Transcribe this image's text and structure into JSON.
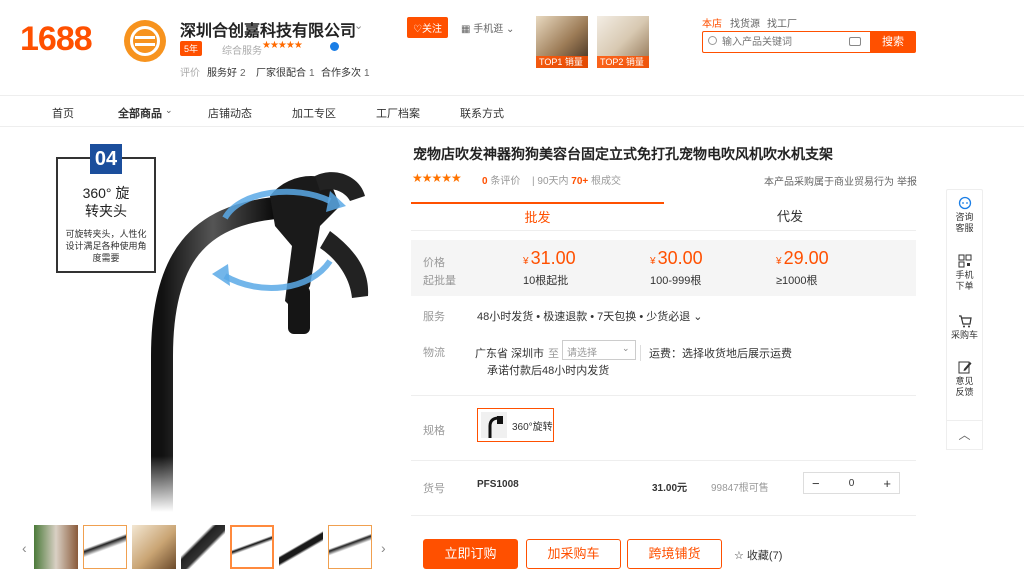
{
  "header": {
    "logo": "1688",
    "shop_name": "深圳合创嘉科技有限公司",
    "years_badge": "5年",
    "rating_label": "综合服务",
    "rating_stars": "★★★★★",
    "eval_label": "评价",
    "evals": [
      {
        "label": "服务好",
        "count": "2"
      },
      {
        "label": "厂家很配合",
        "count": "1"
      },
      {
        "label": "合作多次",
        "count": "1"
      }
    ],
    "follow": "♡关注",
    "mobile": "手机逛",
    "top_thumbs": [
      "TOP1 销量",
      "TOP2 销量"
    ],
    "search_tabs": [
      "本店",
      "找货源",
      "找工厂"
    ],
    "search_placeholder": "输入产品关键词",
    "search_button": "搜索"
  },
  "nav": [
    "首页",
    "全部商品",
    "店铺动态",
    "加工专区",
    "工厂档案",
    "联系方式"
  ],
  "image": {
    "feature_num": "04",
    "feature_title": "360° 旋\n转夹头",
    "feature_desc": "可旋转夹头，人性化设计满足各种使用角度需要"
  },
  "product": {
    "title": "宠物店吹发神器狗狗美容台固定立式免打孔宠物电吹风机吹水机支架",
    "stars": "★★★★★",
    "eval_count": "0",
    "eval_text": "条评价",
    "sold_prefix": "90天内",
    "sold_count": "70+",
    "sold_suffix": "根成交",
    "trade_note": "本产品采购属于商业贸易行为",
    "report": "举报"
  },
  "tabs": [
    "批发",
    "代发"
  ],
  "pricing": {
    "price_label": "价格",
    "moq_label": "起批量",
    "tiers": [
      {
        "price": "31.00",
        "moq": "10根起批"
      },
      {
        "price": "30.00",
        "moq": "100-999根"
      },
      {
        "price": "29.00",
        "moq": "≥1000根"
      }
    ],
    "currency": "¥"
  },
  "service": {
    "label": "服务",
    "text": "48小时发货 • 极速退款 • 7天包换 • 少货必退 ⌄"
  },
  "shipping": {
    "label": "物流",
    "from": "广东省 深圳市",
    "to": "至",
    "select": "请选择",
    "fee": "运费：选择收货地后展示运费",
    "promise": "承诺付款后48小时内发货"
  },
  "spec": {
    "label": "规格",
    "option": "360°旋转"
  },
  "sku": {
    "label": "货号",
    "code": "PFS1008",
    "price": "31.00元",
    "stock": "99847根可售",
    "qty": "0",
    "minus": "−",
    "plus": "+"
  },
  "actions": {
    "buy": "立即订购",
    "cart": "加采购车",
    "cross": "跨境铺货",
    "fav": "☆ 收藏(7)"
  },
  "sidebar": [
    {
      "label": "咨询\n客服",
      "icon": "chat-icon"
    },
    {
      "label": "手机\n下单",
      "icon": "qr-icon"
    },
    {
      "label": "采购车",
      "icon": "cart-icon"
    },
    {
      "label": "意见\n反馈",
      "icon": "edit-icon"
    }
  ]
}
